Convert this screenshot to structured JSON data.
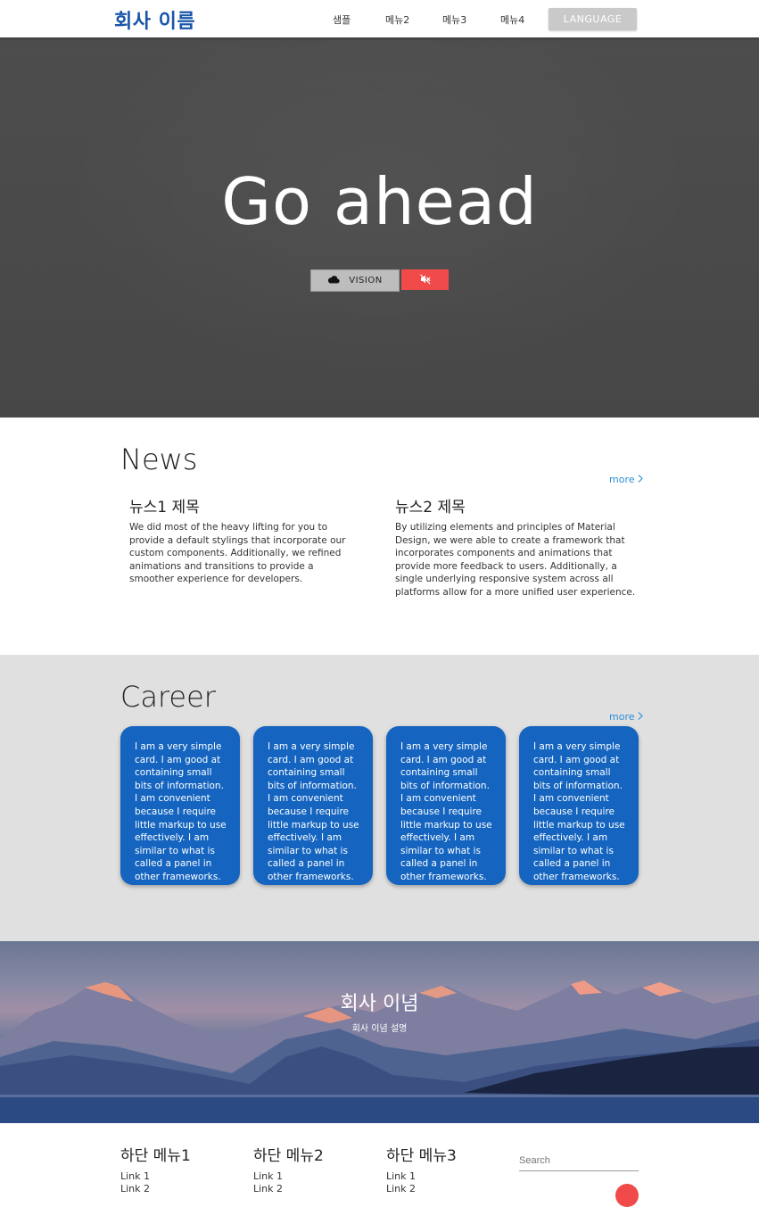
{
  "navbar": {
    "brand": "회사 이름",
    "menu": [
      "샘플",
      "메뉴2",
      "메뉴3",
      "메뉴4"
    ],
    "language": "LANGUAGE"
  },
  "hero": {
    "title": "Go ahead",
    "vision_label": "VISION",
    "icons": [
      "cloud-icon",
      "volume-off-icon"
    ]
  },
  "news": {
    "title": "News",
    "more": "more",
    "items": [
      {
        "title": "뉴스1 제목",
        "body": "We did most of the heavy lifting for you to provide a default stylings that incorporate our custom components. Additionally, we refined animations and transitions to provide a smoother experience for developers."
      },
      {
        "title": "뉴스2 제목",
        "body": "By utilizing elements and principles of Material Design, we were able to create a framework that incorporates components and animations that provide more feedback to users. Additionally, a single underlying responsive system across all platforms allow for a more unified user experience."
      }
    ]
  },
  "career": {
    "title": "Career",
    "more": "more",
    "cards": [
      "I am a very simple card. I am good at containing small bits of information. I am convenient because I require little markup to use effectively. I am similar to what is called a panel in other frameworks.",
      "I am a very simple card. I am good at containing small bits of information. I am convenient because I require little markup to use effectively. I am similar to what is called a panel in other frameworks.",
      "I am a very simple card. I am good at containing small bits of information. I am convenient because I require little markup to use effectively. I am similar to what is called a panel in other frameworks.",
      "I am a very simple card. I am good at containing small bits of information. I am convenient because I require little markup to use effectively. I am similar to what is called a panel in other frameworks."
    ]
  },
  "vision": {
    "title": "회사 이념",
    "subtitle": "회사 이념 설명"
  },
  "footer": {
    "menus": [
      {
        "title": "하단 메뉴1",
        "link1": "Link 1",
        "link2": "Link 2"
      },
      {
        "title": "하단 메뉴2",
        "link1": "Link 1",
        "link2": "Link 2"
      },
      {
        "title": "하단 메뉴3",
        "link1": "Link 1",
        "link2": "Link 2"
      }
    ],
    "search_placeholder": "Search"
  },
  "colors": {
    "brand": "#1a56a8",
    "card": "#1565c0",
    "accent_red": "#f04a4a",
    "link": "#2b8fd6"
  }
}
